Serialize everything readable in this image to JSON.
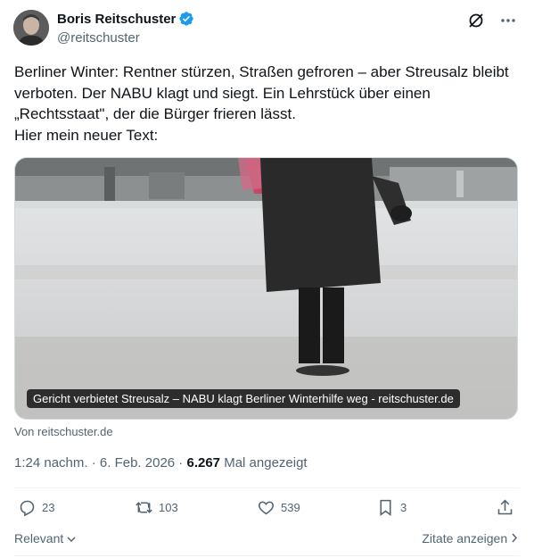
{
  "author": {
    "name": "Boris Reitschuster",
    "handle": "@reitschuster"
  },
  "tweet": {
    "lines": [
      "Berliner Winter: Rentner stürzen, Straßen gefroren – aber Streusalz bleibt",
      "verboten. Der NABU klagt und siegt. Ein Lehrstück über einen",
      "„Rechtsstaat\", der die Bürger frieren lässt.",
      "Hier mein neuer Text:"
    ]
  },
  "card": {
    "caption": "Gericht verbietet Streusalz – NABU klagt Berliner Winterhilfe weg - reitschuster.de",
    "source": "Von reitschuster.de"
  },
  "meta": {
    "time": "1:24 nachm.",
    "sep1": " · ",
    "date": "6. Feb. 2026",
    "sep2": " · ",
    "views": "6.267",
    "views_label": " Mal angezeigt"
  },
  "actions": {
    "replies": "23",
    "reposts": "103",
    "likes": "539",
    "bookmarks": "3"
  },
  "footer": {
    "sort_label": "Relevant",
    "quotes_label": "Zitate anzeigen"
  },
  "colors": {
    "verified": "#1d9bf0",
    "muted": "#536471",
    "text": "#0f1419"
  }
}
